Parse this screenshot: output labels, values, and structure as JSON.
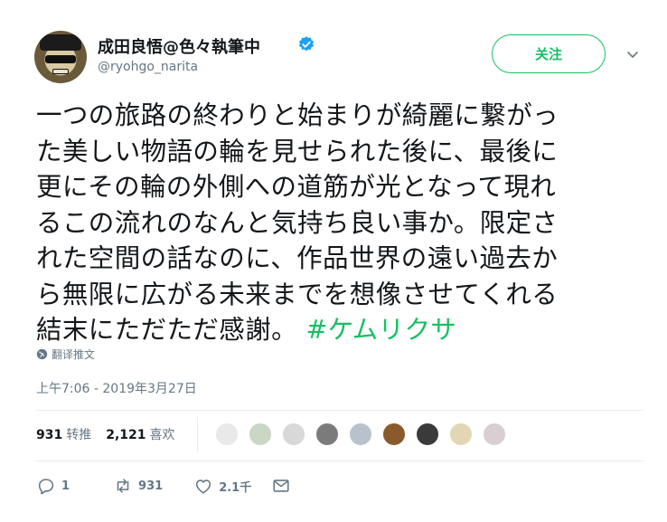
{
  "user": {
    "display_name": "成田良悟@色々執筆中",
    "screen_name": "@ryohgo_narita",
    "verified": true
  },
  "follow_button_label": "关注",
  "tweet": {
    "lines": [
      "一つの旅路の終わりと始まりが綺麗に繋がっ",
      "た美しい物語の輪を見せられた後に、最後に",
      "更にその輪の外側への道筋が光となって現れ",
      "るこの流れのなんと気持ち良い事か。限定さ",
      "れた空間の話なのに、作品世界の遠い過去か",
      "ら無限に広がる未来までを想像させてくれる"
    ],
    "last_line_text": "結末にただただ感謝。 ",
    "hashtag": "#ケムリクサ"
  },
  "translate_label": "翻译推文",
  "timestamp": "上午7:06 - 2019年3月27日",
  "stats": {
    "retweets": "931",
    "retweets_label": "转推",
    "likes": "2,121",
    "likes_label": "喜欢"
  },
  "likers": [
    "#e9e9e9",
    "#c9d7c4",
    "#d8d8d8",
    "#7b7b7b",
    "#b8c2cc",
    "#8a5a2c",
    "#3a3a3a",
    "#e2d6b5",
    "#d9cfd2"
  ],
  "actions": {
    "reply_count": "1",
    "retweet_count": "931",
    "like_count": "2.1千"
  },
  "colors": {
    "accent": "#17bf63",
    "secondary_text": "#657786",
    "verified": "#1da1f2"
  }
}
